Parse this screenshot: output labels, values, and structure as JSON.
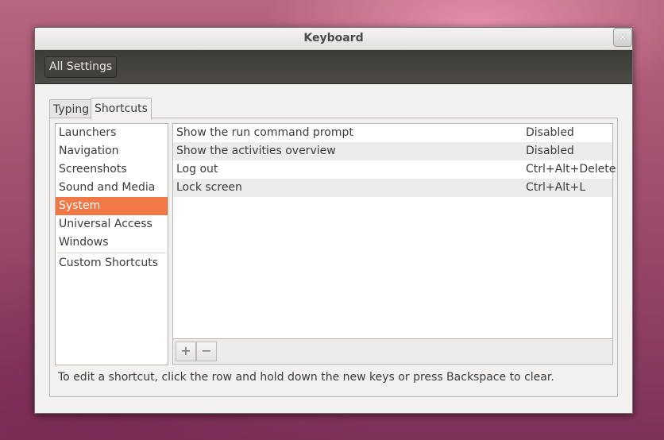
{
  "window": {
    "title": "Keyboard",
    "close_icon": "close-icon"
  },
  "toolbar": {
    "all_settings_label": "All Settings"
  },
  "tabs": [
    {
      "label": "Typing",
      "active": false
    },
    {
      "label": "Shortcuts",
      "active": true
    }
  ],
  "categories": {
    "items": [
      "Launchers",
      "Navigation",
      "Screenshots",
      "Sound and Media",
      "System",
      "Universal Access",
      "Windows"
    ],
    "selected": "System",
    "custom": "Custom Shortcuts"
  },
  "shortcuts": [
    {
      "name": "Show the run command prompt",
      "key": "Disabled"
    },
    {
      "name": "Show the activities overview",
      "key": "Disabled"
    },
    {
      "name": "Log out",
      "key": "Ctrl+Alt+Delete"
    },
    {
      "name": "Lock screen",
      "key": "Ctrl+Alt+L"
    }
  ],
  "list_toolbar": {
    "add_label": "+",
    "remove_label": "−"
  },
  "hint": "To edit a shortcut, click the row and hold down the new keys or press Backspace to clear.",
  "colors": {
    "selection": "#f07746",
    "toolbar_dark": "#3d3b37"
  }
}
